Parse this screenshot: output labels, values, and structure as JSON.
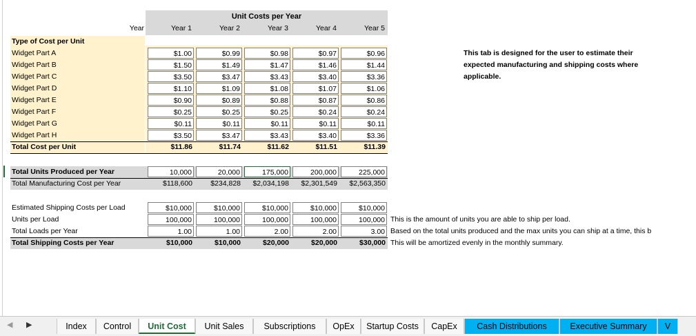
{
  "header": {
    "title": "Unit Costs per Year",
    "year_label": "Year",
    "years": [
      "Year 1",
      "Year 2",
      "Year 3",
      "Year 4",
      "Year 5"
    ]
  },
  "costs": {
    "section_label": "Type of Cost per Unit",
    "rows": [
      {
        "label": "Widget Part A",
        "values": [
          "$1.00",
          "$0.99",
          "$0.98",
          "$0.97",
          "$0.96"
        ]
      },
      {
        "label": "Widget Part B",
        "values": [
          "$1.50",
          "$1.49",
          "$1.47",
          "$1.46",
          "$1.44"
        ]
      },
      {
        "label": "Widget Part C",
        "values": [
          "$3.50",
          "$3.47",
          "$3.43",
          "$3.40",
          "$3.36"
        ]
      },
      {
        "label": "Widget Part D",
        "values": [
          "$1.10",
          "$1.09",
          "$1.08",
          "$1.07",
          "$1.06"
        ]
      },
      {
        "label": "Widget Part E",
        "values": [
          "$0.90",
          "$0.89",
          "$0.88",
          "$0.87",
          "$0.86"
        ]
      },
      {
        "label": "Widget Part F",
        "values": [
          "$0.25",
          "$0.25",
          "$0.25",
          "$0.24",
          "$0.24"
        ]
      },
      {
        "label": "Widget Part G",
        "values": [
          "$0.11",
          "$0.11",
          "$0.11",
          "$0.11",
          "$0.11"
        ]
      },
      {
        "label": "Widget Part H",
        "values": [
          "$3.50",
          "$3.47",
          "$3.43",
          "$3.40",
          "$3.36"
        ]
      }
    ],
    "total": {
      "label": "Total Cost per Unit",
      "values": [
        "$11.86",
        "$11.74",
        "$11.62",
        "$11.51",
        "$11.39"
      ]
    }
  },
  "production": {
    "units": {
      "label": "Total Units Produced per Year",
      "values": [
        "10,000",
        "20,000",
        "175,000",
        "200,000",
        "225,000"
      ]
    },
    "manufacturing": {
      "label": "Total Manufacturing Cost per Year",
      "values": [
        "$118,600",
        "$234,828",
        "$2,034,198",
        "$2,301,549",
        "$2,563,350"
      ]
    }
  },
  "shipping": {
    "est_cost": {
      "label": "Estimated Shipping Costs per Load",
      "values": [
        "$10,000",
        "$10,000",
        "$10,000",
        "$10,000",
        "$10,000"
      ]
    },
    "units_per_load": {
      "label": "Units per Load",
      "values": [
        "100,000",
        "100,000",
        "100,000",
        "100,000",
        "100,000"
      ],
      "note": "This is the amount of units you are able to ship per load."
    },
    "loads": {
      "label": "Total Loads per Year",
      "values": [
        "1.00",
        "1.00",
        "2.00",
        "2.00",
        "3.00"
      ],
      "note": "Based on the total units produced and the max units you can ship at a time, this b"
    },
    "total": {
      "label": "Total Shipping Costs per Year",
      "values": [
        "$10,000",
        "$10,000",
        "$20,000",
        "$20,000",
        "$30,000"
      ],
      "note": "This will be amortized evenly in the monthly summary."
    }
  },
  "side_note": {
    "lines": [
      "This tab is designed for the user to estimate their",
      "expected manufacturing and shipping costs where",
      "applicable."
    ]
  },
  "tabs": [
    "Index",
    "Control",
    "Unit Cost",
    "Unit Sales",
    "Subscriptions",
    "OpEx",
    "Startup Costs",
    "CapEx",
    "Cash Distributions",
    "Executive Summary",
    "V"
  ],
  "active_tab": "Unit Cost"
}
